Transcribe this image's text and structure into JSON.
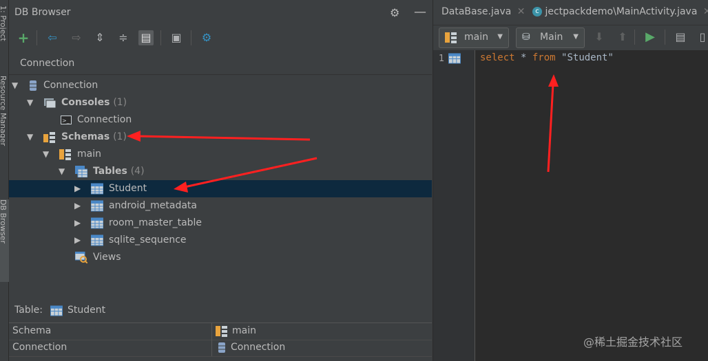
{
  "side_tabs": {
    "project": "1: Project",
    "resource_manager": "Resource Manager",
    "db_browser": "DB Browser"
  },
  "db_browser": {
    "title": "DB Browser",
    "connection_selector": "Connection",
    "tree": {
      "connection": "Connection",
      "consoles_label": "Consoles",
      "consoles_count": "(1)",
      "console_connection": "Connection",
      "schemas_label": "Schemas",
      "schemas_count": "(1)",
      "schema_main": "main",
      "tables_label": "Tables",
      "tables_count": "(4)",
      "tables": [
        "Student",
        "android_metadata",
        "room_master_table",
        "sqlite_sequence"
      ],
      "views": "Views"
    },
    "table_info": {
      "label": "Table:",
      "value": "Student"
    },
    "properties": [
      {
        "name": "Schema",
        "value": "main"
      },
      {
        "name": "Connection",
        "value": "Connection"
      }
    ]
  },
  "editor": {
    "tabs": [
      "DataBase.java",
      "jectpackdemo\\MainActivity.java"
    ],
    "schema_combo": "main",
    "session_combo": "Main",
    "line_number": "1",
    "code": {
      "kw1": "select",
      "star": " * ",
      "kw2": "from",
      "space": " ",
      "str": "\"Student\""
    }
  },
  "watermark": "@稀土掘金技术社区",
  "colors": {
    "keyword": "#cc7832",
    "string": "#6a8759",
    "selection": "#0d293e",
    "arrow": "#ff2020",
    "table_icon": "#4a88c7",
    "schema_icon": "#e8a33d"
  }
}
